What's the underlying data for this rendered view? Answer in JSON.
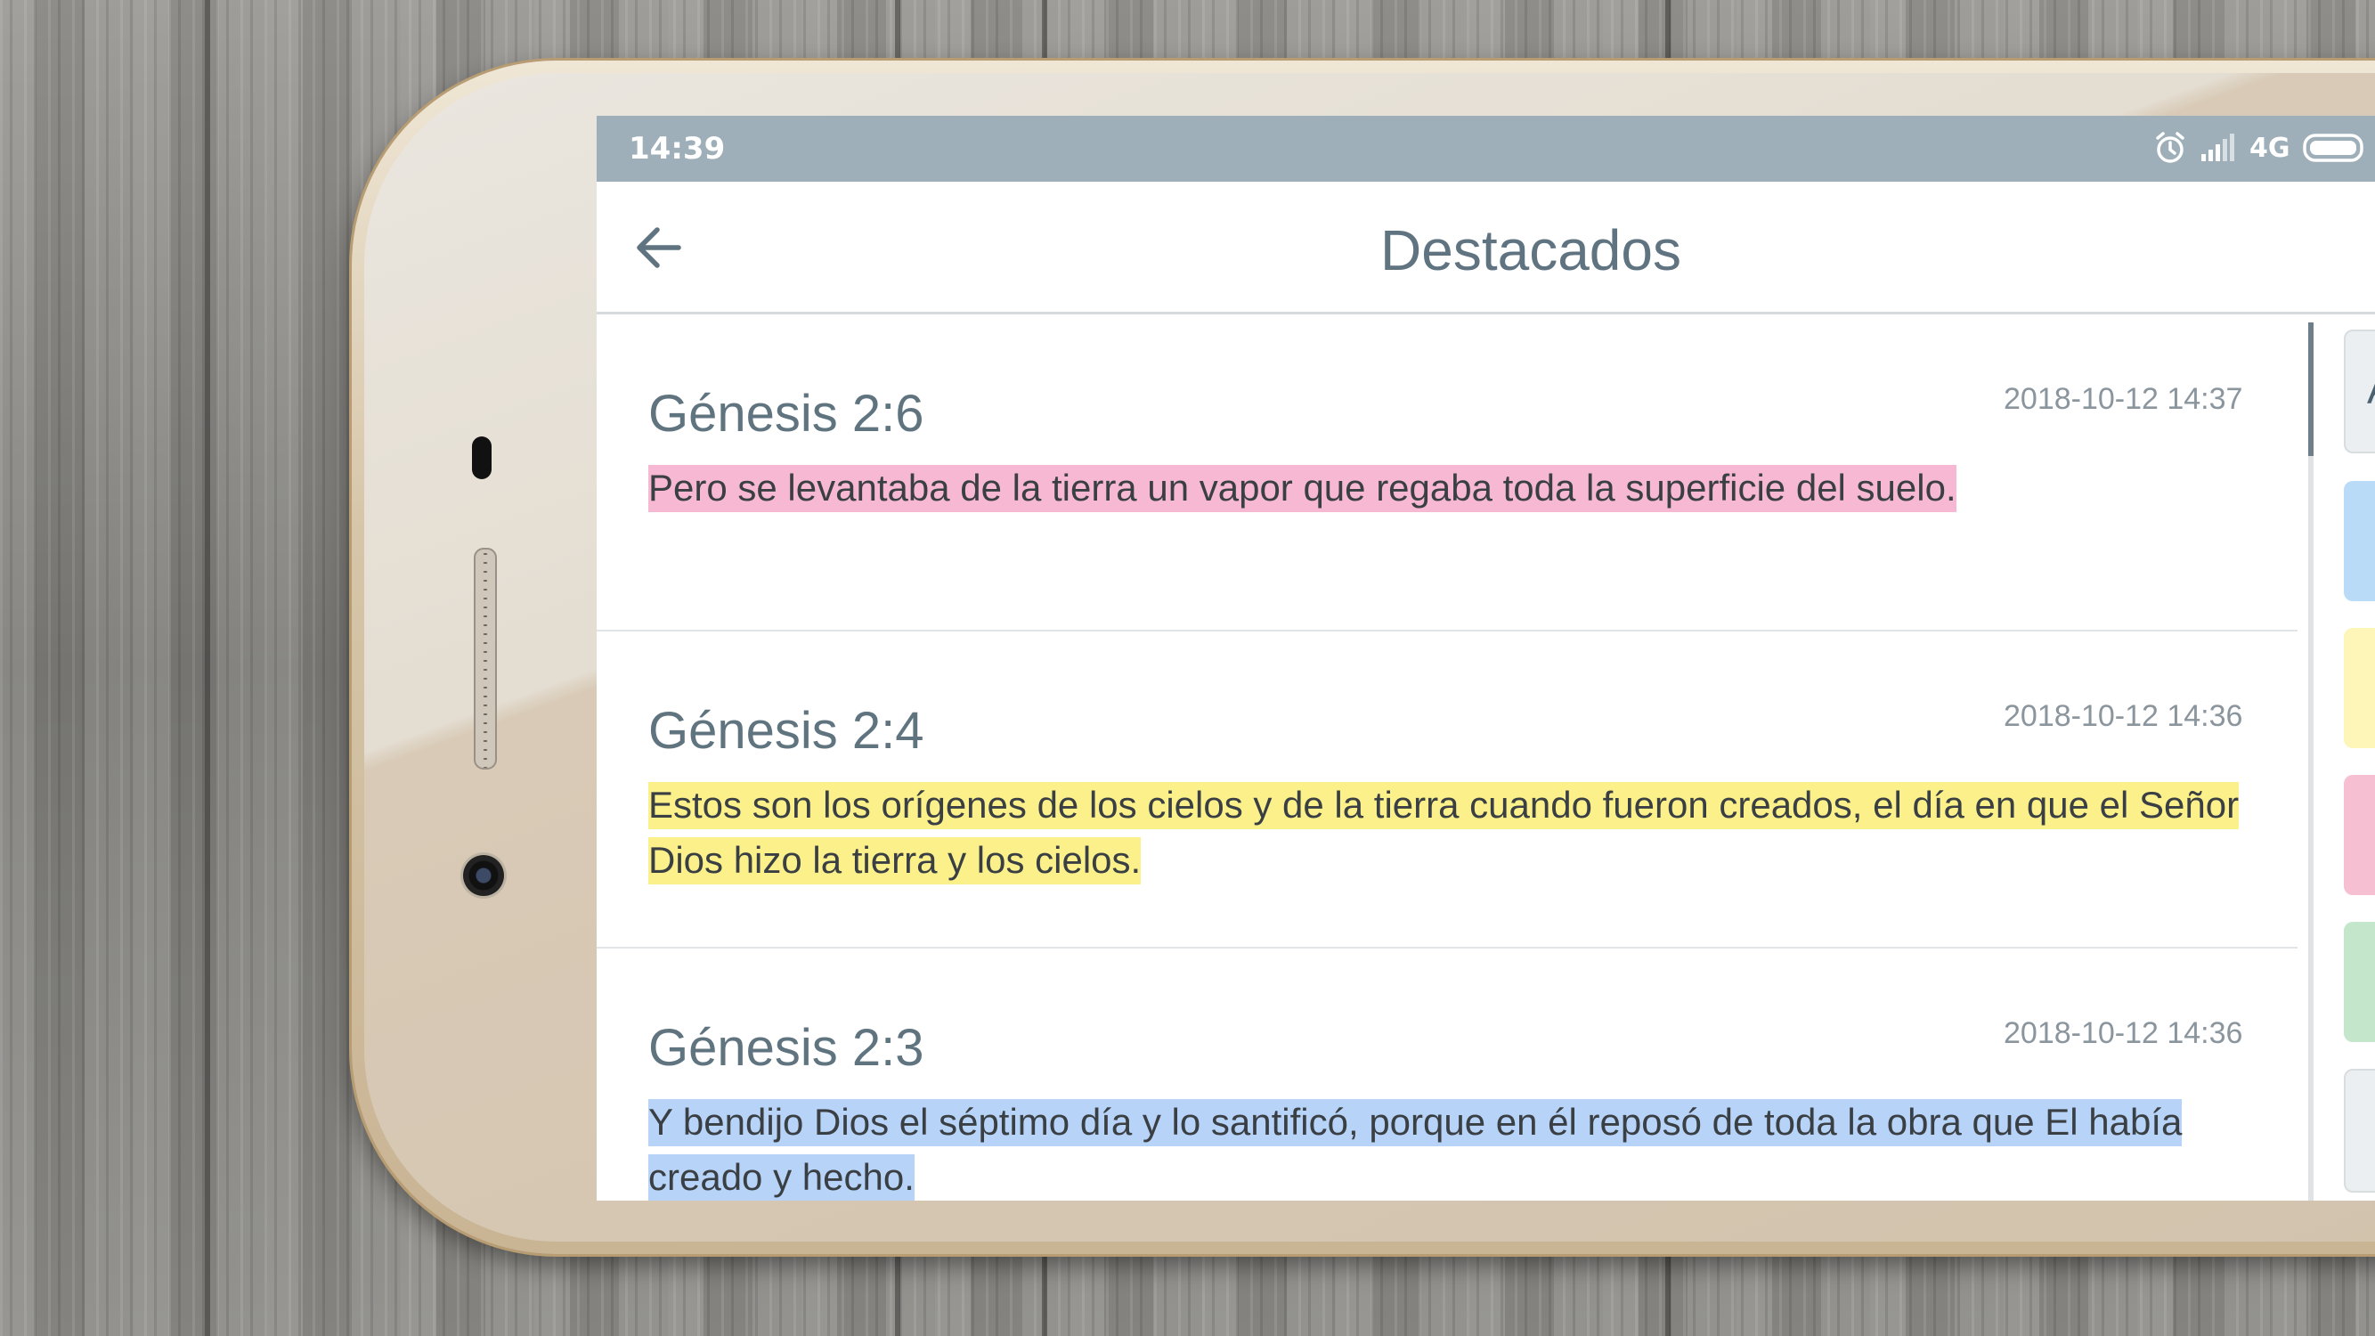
{
  "status_bar": {
    "time": "14:39",
    "network": "4G",
    "icons": [
      "alarm-icon",
      "signal-icon",
      "battery-icon"
    ]
  },
  "app_bar": {
    "title": "Destacados",
    "back_icon": "arrow-left-icon"
  },
  "highlights": [
    {
      "reference": "Génesis 2:6",
      "date": "2018-10-12 14:37",
      "text": "Pero se levantaba de la tierra un vapor que regaba toda la superficie del suelo.",
      "color": "#f7b8d3"
    },
    {
      "reference": "Génesis 2:4",
      "date": "2018-10-12 14:36",
      "text": "Estos son los orígenes de los cielos y de la tierra cuando fueron creados, el día en que el Señor Dios hizo la tierra y los cielos.",
      "color": "#fbf08a"
    },
    {
      "reference": "Génesis 2:3",
      "date": "2018-10-12 14:36",
      "text": "Y bendijo Dios el séptimo día y lo santificó, porque en él reposó de toda la obra que El había creado y hecho.",
      "color": "#b7d3f7"
    }
  ],
  "color_filter": {
    "all_label": "A",
    "colors": [
      "#b9dbf7",
      "#fdf6b8",
      "#f7bfd2",
      "#c4e6cb",
      "#eceff1"
    ]
  }
}
